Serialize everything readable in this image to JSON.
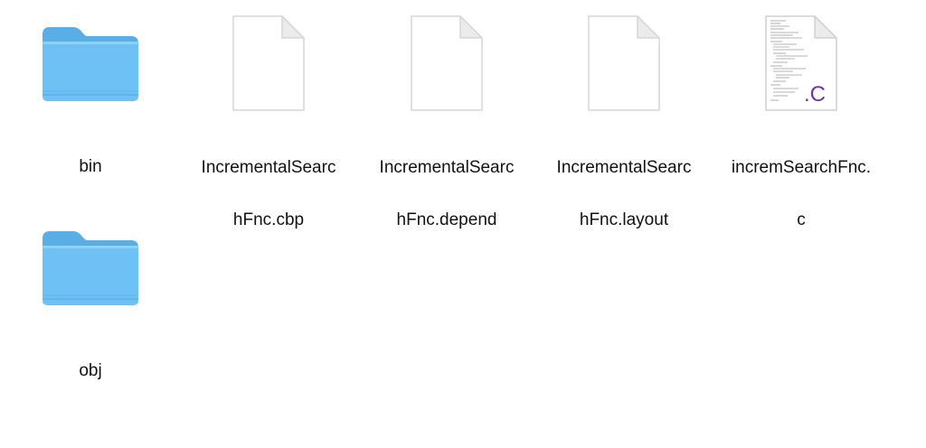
{
  "window": {
    "view": "icon-view"
  },
  "items": [
    {
      "name_line1": "bin",
      "name_line2": "",
      "kind": "folder",
      "icon": "folder-icon"
    },
    {
      "name_line1": "IncrementalSearc",
      "name_line2": "hFnc.cbp",
      "kind": "document",
      "icon": "blank-document-icon"
    },
    {
      "name_line1": "IncrementalSearc",
      "name_line2": "hFnc.depend",
      "kind": "document",
      "icon": "blank-document-icon"
    },
    {
      "name_line1": "IncrementalSearc",
      "name_line2": "hFnc.layout",
      "kind": "document",
      "icon": "blank-document-icon"
    },
    {
      "name_line1": "incremSearchFnc.",
      "name_line2": "c",
      "kind": "c-source",
      "icon": "c-source-file-icon",
      "badge": ".C"
    },
    {
      "name_line1": "obj",
      "name_line2": "",
      "kind": "folder",
      "icon": "folder-icon"
    }
  ],
  "colors": {
    "folder_front": "#6ec1f4",
    "folder_back": "#5aaee6",
    "c_badge": "#6a35a8",
    "label_text": "#111111"
  }
}
